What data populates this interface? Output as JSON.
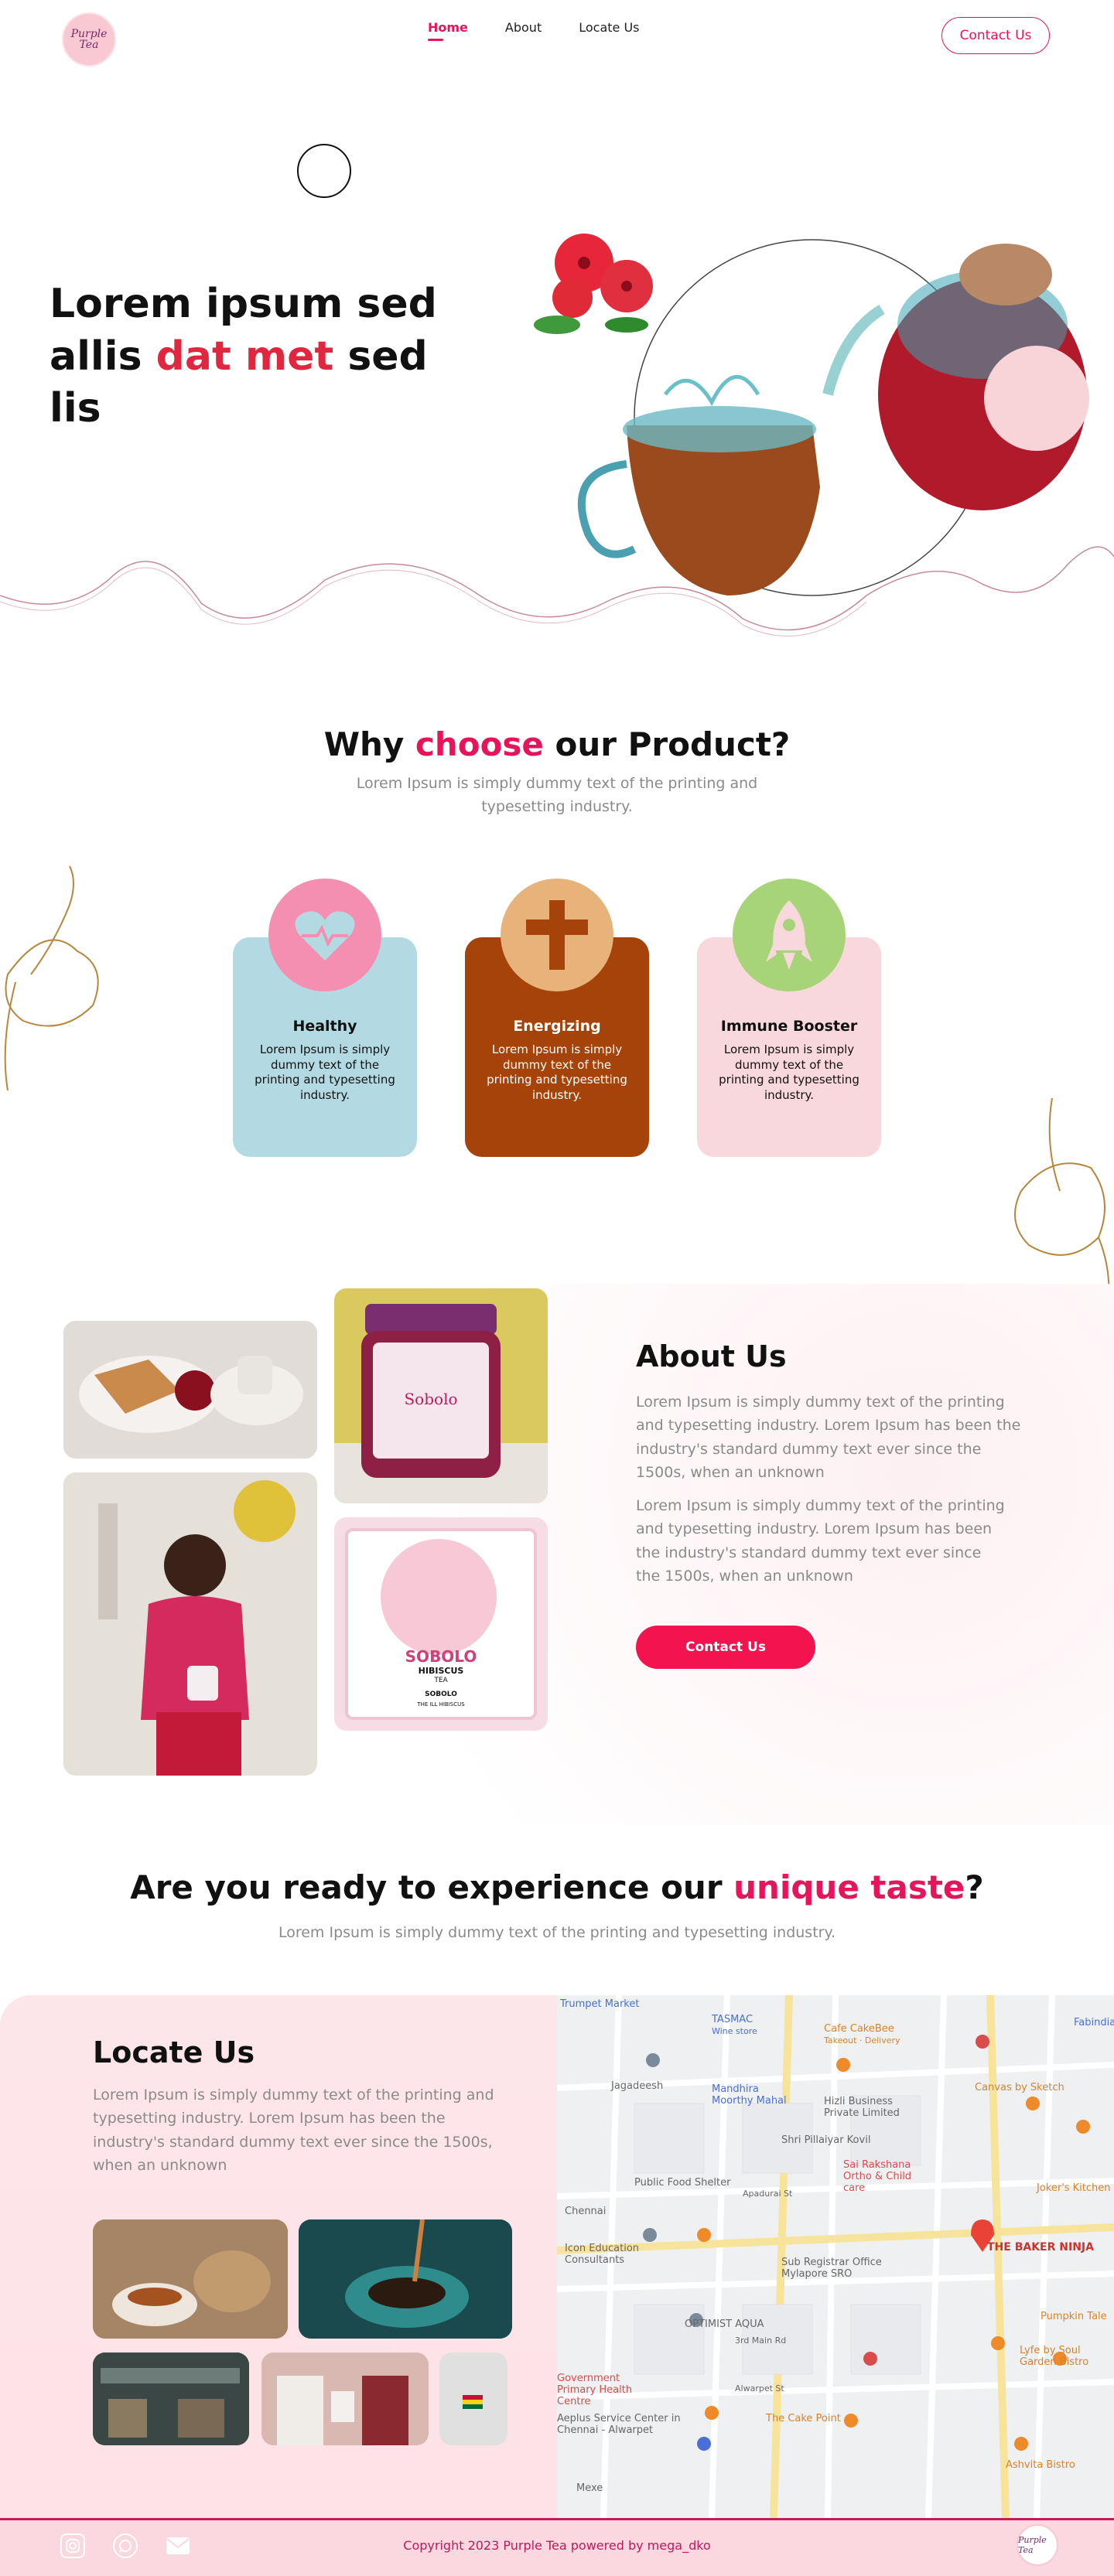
{
  "nav": {
    "logo_text": "Purple Tea",
    "items": [
      {
        "label": "Home",
        "active": true
      },
      {
        "label": "About",
        "active": false
      },
      {
        "label": "Locate Us",
        "active": false
      }
    ],
    "contact_label": "Contact Us"
  },
  "hero": {
    "title_part1": "Lorem ipsum sed allis ",
    "title_accent": "dat met",
    "title_part2": " sed lis"
  },
  "why": {
    "title_part1": "Why ",
    "title_accent": "choose",
    "title_part2": " our Product?",
    "subtitle": "Lorem Ipsum is simply dummy text of the printing and typesetting industry.",
    "cards": [
      {
        "title": "Healthy",
        "text": "Lorem Ipsum is simply dummy text of the printing and typesetting industry.",
        "icon": "heart-pulse-icon",
        "color": "#b3dae2",
        "icon_bg": "#f58fb2"
      },
      {
        "title": "Energizing",
        "text": "Lorem Ipsum is simply dummy text of the printing and typesetting industry.",
        "icon": "energy-cross-icon",
        "color": "#a5430a",
        "icon_bg": "#e8b37a"
      },
      {
        "title": "Immune Booster",
        "text": "Lorem Ipsum is simply dummy text of the printing and typesetting industry.",
        "icon": "rocket-icon",
        "color": "#f8d8dc",
        "icon_bg": "#a8d479"
      }
    ]
  },
  "about": {
    "title": "About Us",
    "p1": "Lorem Ipsum is simply dummy text of the printing and typesetting industry. Lorem Ipsum has been the industry's  standard dummy text ever since the 1500s, when an unknown",
    "p2": "Lorem Ipsum is simply dummy text of the printing and typesetting industry. Lorem Ipsum has been the industry's  standard dummy text ever since the 1500s, when an unknown",
    "button": "Contact Us",
    "package_brand": "SOBOLO",
    "package_sub": "HIBISCUS",
    "package_sub2": "TEA",
    "package_footer": "SOBOLO",
    "package_footer2": "THE ILL HIBISCUS",
    "jar_label": "Sobolo"
  },
  "ready": {
    "title_part1": "Are you ready to experience our ",
    "title_accent": "unique taste",
    "title_part2": "?",
    "subtitle": "Lorem Ipsum is simply dummy text of the printing and typesetting industry."
  },
  "locate": {
    "title": "Locate Us",
    "text": "Lorem Ipsum is simply dummy text of the printing and typesetting industry. Lorem Ipsum has been the industry's  standard dummy text ever since the 1500s, when an unknown"
  },
  "map": {
    "labels": [
      "Trumpet Market",
      "TASMAC",
      "Wine store",
      "Cafe CakeBee",
      "Takeout · Delivery",
      "Fabindia",
      "Jagadeesh",
      "Mandhira Moorthy Mahal",
      "Hizli Business Private Limited",
      "Canvas by Sketch",
      "Shri Pillaiyar Kovil",
      "Public Food Shelter",
      "Sai Rakshana Ortho & Child care",
      "Joker's Kitchen",
      "Chennai",
      "Apadurai St",
      "Icon Education Consultants",
      "Sub Registrar Office Mylapore SRO",
      "OPTIMIST AQUA",
      "3rd Main Rd",
      "Pumpkin Tale",
      "Lyfe by Soul Garden Bistro",
      "Government Primary Health Centre",
      "Alwarpet St",
      "Aeplus Service Center in Chennai - Alwarpet",
      "The Cake Point",
      "Ashvita Bistro",
      "Mexe"
    ],
    "highlight": "THE BAKER NINJA"
  },
  "footer": {
    "copyright": "Copyright 2023 Purple Tea powered by  mega_dko",
    "icons": [
      "instagram-icon",
      "whatsapp-icon",
      "mail-icon"
    ]
  }
}
